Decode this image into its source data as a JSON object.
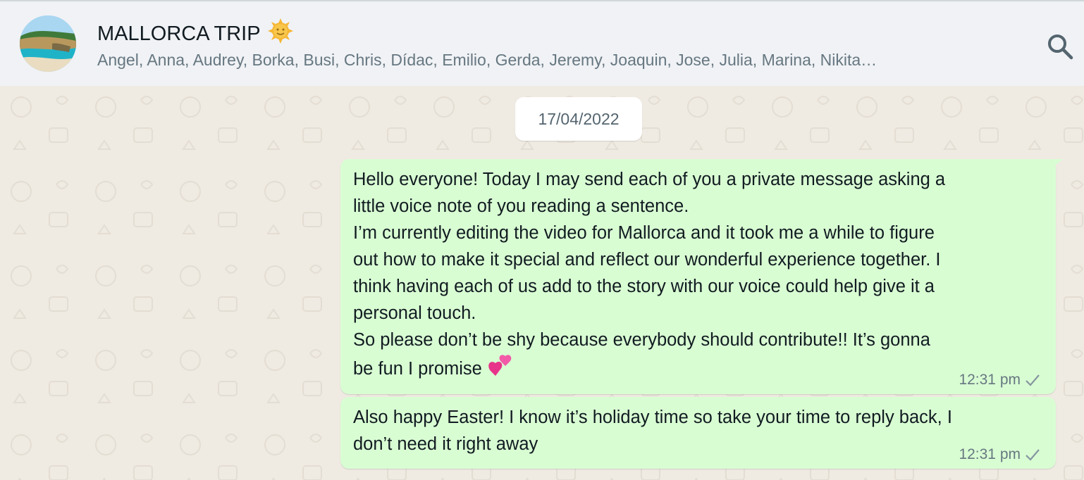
{
  "header": {
    "title": "MALLORCA TRIP",
    "title_emoji": "sun-with-face-icon",
    "members": "Angel, Anna, Audrey, Borka, Busi, Chris, Dídac, Emilio, Gerda, Jeremy, Joaquin, Jose, Julia, Marina, Nikita…",
    "search_icon": "search-icon"
  },
  "chat": {
    "date_label": "17/04/2022",
    "messages": [
      {
        "text": "Hello everyone! Today I may send each of you a private message asking a\nlittle voice note of you reading a sentence.\nI’m currently editing the video for Mallorca and it took me a while to figure\nout how to make it special and reflect our wonderful experience together. I\nthink having each of us add to the story with our voice could help give it a\npersonal touch.\nSo please don’t be shy because everybody should contribute!! It’s gonna\nbe fun I promise ",
        "emoji": "two-hearts-icon",
        "time": "12:31 pm",
        "status": "sent-check-icon"
      },
      {
        "text": "Also happy Easter! I know it’s holiday time so take your time to reply back, I\ndon’t need it right away",
        "time": "12:31 pm",
        "status": "sent-check-icon"
      }
    ]
  },
  "colors": {
    "header_bg": "#f0f2f5",
    "chat_bg": "#efeae2",
    "outgoing_bubble": "#d9fdd3",
    "secondary_text": "#667781"
  }
}
